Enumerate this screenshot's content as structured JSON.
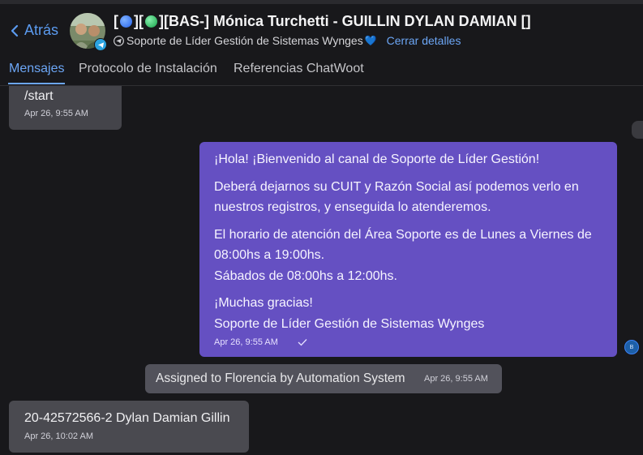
{
  "header": {
    "back_label": "Atrás",
    "title_prefix": "[",
    "title_mid": "][",
    "title_rest": "][BAS-] Mónica Turchetti - GUILLIN DYLAN DAMIAN []",
    "inbox_name": "Soporte de Líder Gestión de Sistemas Wynges",
    "heart": "💙",
    "close_details": "Cerrar detalles",
    "dot1_color": "#3b82f6",
    "dot2_color": "#22c55e"
  },
  "tabs": [
    {
      "label": "Mensajes",
      "active": true
    },
    {
      "label": "Protocolo de Instalación",
      "active": false
    },
    {
      "label": "Referencias ChatWoot",
      "active": false
    }
  ],
  "messages": {
    "m1": {
      "text": "/start",
      "time": "Apr 26, 9:55 AM"
    },
    "m2": {
      "lines": [
        "¡Hola! ¡Bienvenido al canal de Soporte de Líder Gestión!",
        "Deberá dejarnos su CUIT y Razón Social así podemos verlo en",
        "nuestros registros, y enseguida lo atenderemos.",
        "El horario de atención del Área Soporte es de Lunes a Viernes de",
        "08:00hs a 19:00hs.",
        "Sábados de 08:00hs a 12:00hs.",
        "¡Muchas gracias!",
        "Soporte de Líder Gestión de Sistemas Wynges"
      ],
      "time": "Apr 26, 9:55 AM",
      "sender_initial": "B"
    },
    "m3": {
      "text": "Assigned to Florencia by Automation System",
      "time": "Apr 26, 9:55 AM"
    },
    "m4": {
      "text": "20-42572566-2 Dylan Damian Gillin",
      "time": "Apr 26, 10:02 AM"
    }
  },
  "colors": {
    "accent": "#6ca6f5",
    "outgoing": "#6550c2",
    "background": "#18181b"
  }
}
